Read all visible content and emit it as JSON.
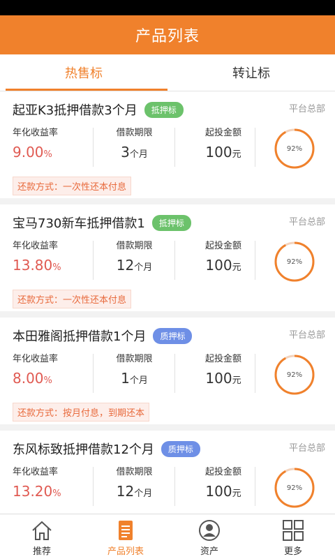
{
  "header": {
    "title": "产品列表"
  },
  "tabs": [
    {
      "label": "热售标"
    },
    {
      "label": "转让标"
    }
  ],
  "colors": {
    "accent": "#f0812c",
    "rate": "#e05a52",
    "badge_green": "#6cc26b",
    "badge_blue": "#6e8fe6"
  },
  "products": [
    {
      "title": "起亚K3抵押借款3个月",
      "badge": "抵押标",
      "badge_color": "#6cc26b",
      "platform": "平台总部",
      "rate_label": "年化收益率",
      "rate": "9.00",
      "rate_unit": "%",
      "term_label": "借款期限",
      "term": "3",
      "term_unit": "个月",
      "min_label": "起投金额",
      "min": "100",
      "min_unit": "元",
      "progress_text": "92%",
      "progress": 0.92,
      "repay": "还款方式：一次性还本付息"
    },
    {
      "title": "宝马730新车抵押借款1",
      "badge": "抵押标",
      "badge_color": "#6cc26b",
      "platform": "平台总部",
      "rate_label": "年化收益率",
      "rate": "13.80",
      "rate_unit": "%",
      "term_label": "借款期限",
      "term": "12",
      "term_unit": "个月",
      "min_label": "起投金额",
      "min": "100",
      "min_unit": "元",
      "progress_text": "92%",
      "progress": 0.92,
      "repay": "还款方式：一次性还本付息"
    },
    {
      "title": "本田雅阁抵押借款1个月",
      "badge": "质押标",
      "badge_color": "#6e8fe6",
      "platform": "平台总部",
      "rate_label": "年化收益率",
      "rate": "8.00",
      "rate_unit": "%",
      "term_label": "借款期限",
      "term": "1",
      "term_unit": "个月",
      "min_label": "起投金额",
      "min": "100",
      "min_unit": "元",
      "progress_text": "92%",
      "progress": 0.92,
      "repay": "还款方式：按月付息，到期还本"
    },
    {
      "title": "东风标致抵押借款12个月",
      "badge": "质押标",
      "badge_color": "#6e8fe6",
      "platform": "平台总部",
      "rate_label": "年化收益率",
      "rate": "13.20",
      "rate_unit": "%",
      "term_label": "借款期限",
      "term": "12",
      "term_unit": "个月",
      "min_label": "起投金额",
      "min": "100",
      "min_unit": "元",
      "progress_text": "92%",
      "progress": 0.92,
      "repay": ""
    }
  ],
  "nav": [
    {
      "label": "推荐",
      "icon": "home-icon"
    },
    {
      "label": "产品列表",
      "icon": "document-list-icon"
    },
    {
      "label": "资产",
      "icon": "user-icon"
    },
    {
      "label": "更多",
      "icon": "grid-icon"
    }
  ]
}
